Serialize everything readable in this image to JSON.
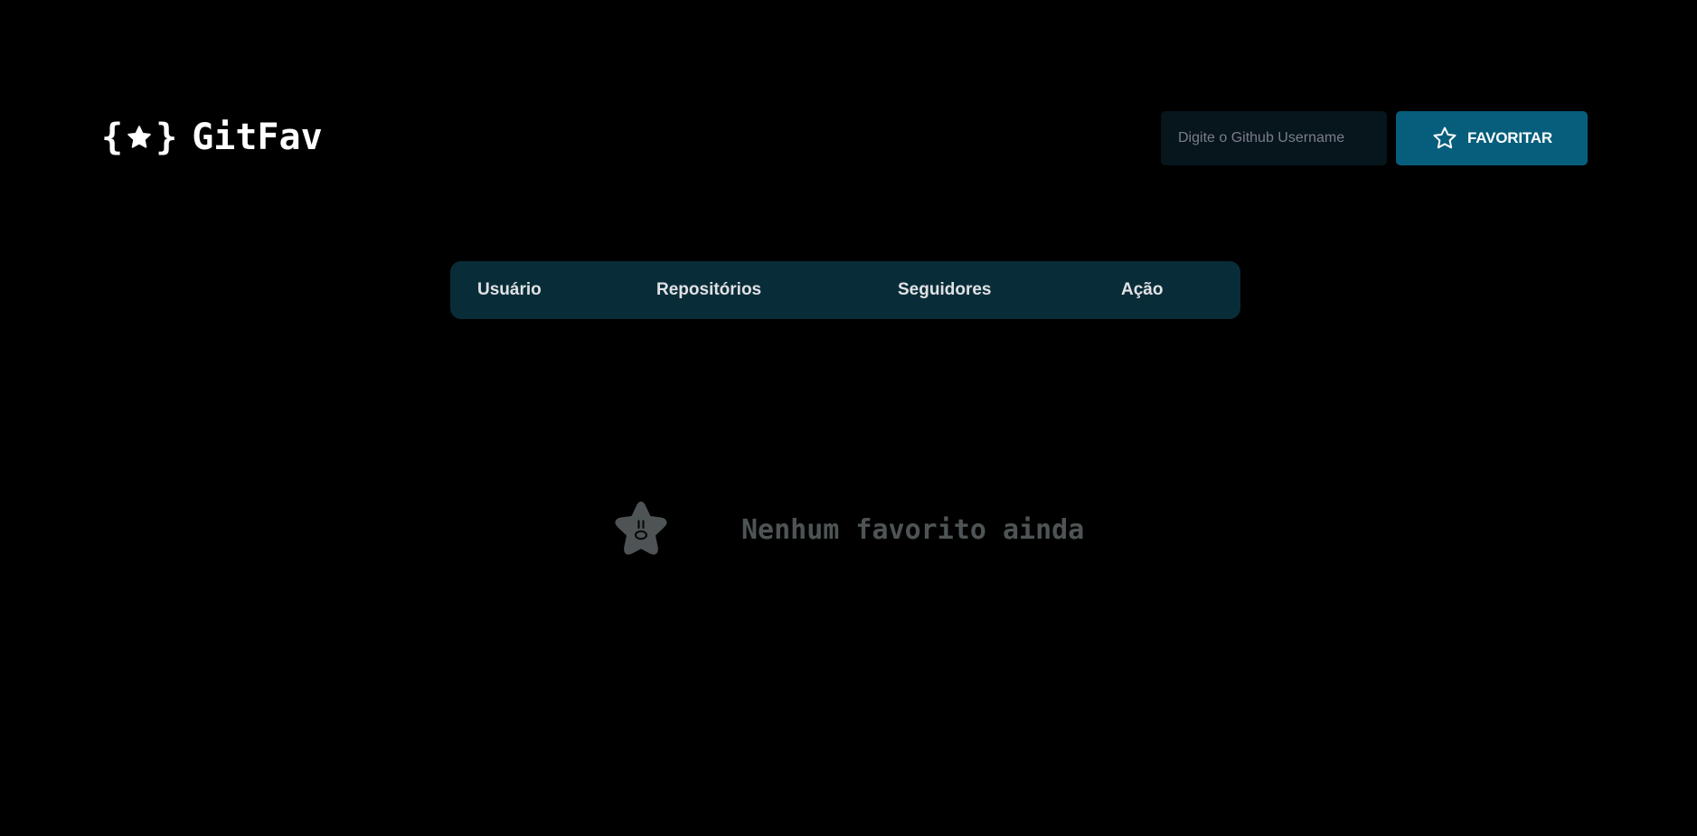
{
  "header": {
    "logo_text": "GitFav",
    "logo_brace_open": "{",
    "logo_brace_close": "}",
    "search": {
      "placeholder": "Digite o Github Username",
      "value": ""
    },
    "favorite_button_label": "FAVORITAR"
  },
  "table": {
    "columns": [
      "Usuário",
      "Repositórios",
      "Seguidores",
      "Ação"
    ],
    "rows": []
  },
  "empty_state": {
    "message": "Nenhum favorito ainda"
  },
  "colors": {
    "background": "#000000",
    "accent": "#065e7c",
    "table_header": "#092d38",
    "input_background": "#06161c",
    "muted_text": "#4e5455"
  },
  "icons": {
    "logo": "star-icon",
    "button": "star-outline-icon",
    "empty": "surprised-star-icon"
  }
}
